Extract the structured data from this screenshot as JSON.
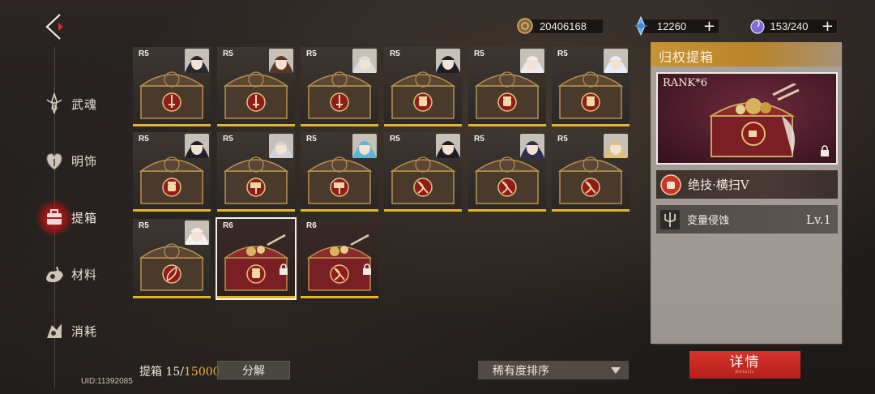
{
  "nav": {
    "items": [
      {
        "label": "武魂",
        "icon": "spirit-icon"
      },
      {
        "label": "明饰",
        "icon": "heart-ornament-icon"
      },
      {
        "label": "提箱",
        "icon": "box-icon",
        "active": true
      },
      {
        "label": "材料",
        "icon": "material-icon"
      },
      {
        "label": "消耗",
        "icon": "consumable-icon"
      }
    ]
  },
  "currency": {
    "gold": {
      "value": "20406168",
      "icon": "coin-icon"
    },
    "crystal": {
      "value": "12260",
      "icon": "crystal-icon"
    },
    "stamina": {
      "value": "153/240",
      "icon": "stamina-orb-icon"
    },
    "plus_label": "+"
  },
  "boxes": [
    {
      "rank": "R5",
      "emblem": "sword"
    },
    {
      "rank": "R5",
      "emblem": "sword"
    },
    {
      "rank": "R5",
      "emblem": "sword"
    },
    {
      "rank": "R5",
      "emblem": "fist"
    },
    {
      "rank": "R5",
      "emblem": "fist"
    },
    {
      "rank": "R5",
      "emblem": "fist"
    },
    {
      "rank": "R5",
      "emblem": "fist"
    },
    {
      "rank": "R5",
      "emblem": "hammer"
    },
    {
      "rank": "R5",
      "emblem": "hammer"
    },
    {
      "rank": "R5",
      "emblem": "bow"
    },
    {
      "rank": "R5",
      "emblem": "bow"
    },
    {
      "rank": "R5",
      "emblem": "bow"
    },
    {
      "rank": "R5",
      "emblem": "feather"
    },
    {
      "rank": "R6",
      "emblem": "fist",
      "locked": true,
      "selected": true
    },
    {
      "rank": "R6",
      "emblem": "bow",
      "locked": true
    }
  ],
  "bottom": {
    "count_prefix": "提箱 ",
    "count_current": "15",
    "count_sep": "/",
    "count_max": "15000",
    "decompose_label": "分解",
    "uid": "UID:11392085",
    "sort_label": "稀有度排序"
  },
  "detail": {
    "title": "归权提箱",
    "rank_text": "RANK*6",
    "skill1_name": "绝技·横扫Ⅴ",
    "skill2_name": "变量侵蚀",
    "skill2_level": "Lv.1",
    "button_label": "详情",
    "button_sub": "Details"
  },
  "colors": {
    "accent_gold": "#e2b531",
    "header_gold": "#c59433",
    "detail_red": "#d7332c",
    "active_red": "#dc2828",
    "count_max_color": "#e9b448"
  }
}
